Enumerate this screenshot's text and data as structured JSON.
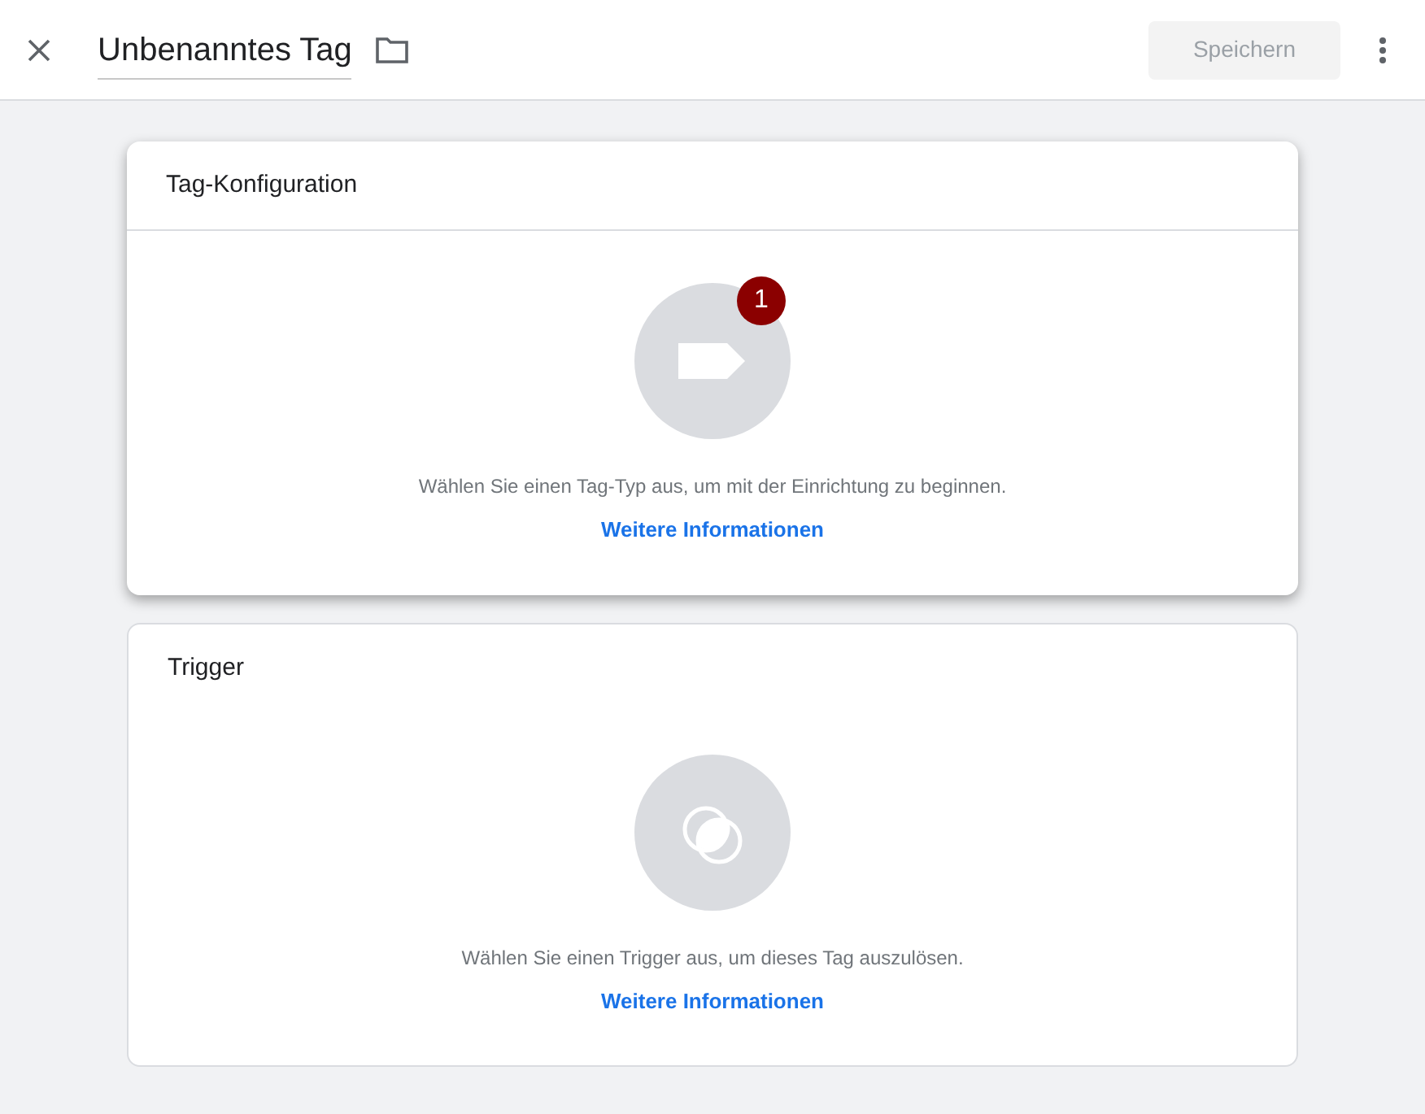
{
  "header": {
    "title": "Unbenanntes Tag",
    "save_button": {
      "label": "Speichern",
      "disabled": true
    }
  },
  "cards": [
    {
      "kind": "tag",
      "title": "Tag-Konfiguration",
      "selected": true,
      "badge": "1",
      "description": "Wählen Sie einen Tag-Typ aus, um mit der Einrichtung zu beginnen.",
      "link": "Weitere Informationen"
    },
    {
      "kind": "trigger",
      "title": "Trigger",
      "selected": false,
      "description": "Wählen Sie einen Trigger aus, um dieses Tag auszulösen.",
      "link": "Weitere Informationen"
    }
  ]
}
